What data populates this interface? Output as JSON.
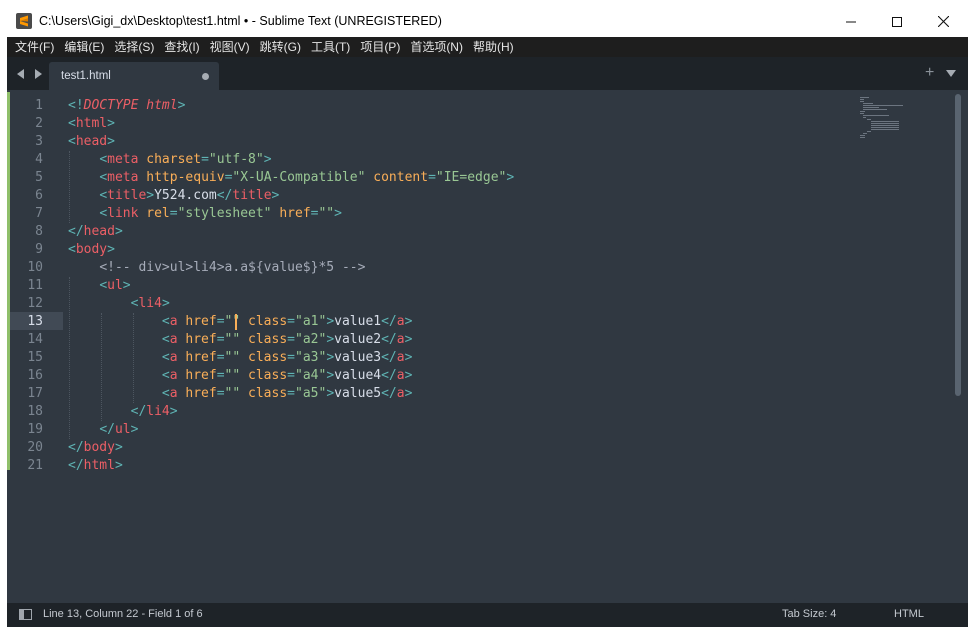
{
  "window": {
    "title": "C:\\Users\\Gigi_dx\\Desktop\\test1.html • - Sublime Text (UNREGISTERED)",
    "app_icon": "sublime-text-logo",
    "controls": [
      "minimize-icon",
      "maximize-icon",
      "close-icon"
    ]
  },
  "menu": [
    "文件(F)",
    "编辑(E)",
    "选择(S)",
    "查找(I)",
    "视图(V)",
    "跳转(G)",
    "工具(T)",
    "项目(P)",
    "首选项(N)",
    "帮助(H)"
  ],
  "tabbar": {
    "tab_label": "test1.html",
    "tab_modified": true,
    "icons": [
      "arrow-left-icon",
      "arrow-right-icon",
      "plus-icon",
      "chevron-down-icon"
    ],
    "add_symbol": "+"
  },
  "editor": {
    "active_line": 13,
    "line_numbers": [
      "1",
      "2",
      "3",
      "4",
      "5",
      "6",
      "7",
      "8",
      "9",
      "10",
      "11",
      "12",
      "13",
      "14",
      "15",
      "16",
      "17",
      "18",
      "19",
      "20",
      "21"
    ],
    "lines": [
      [
        [
          "p",
          "<!"
        ],
        [
          "d",
          "DOCTYPE"
        ],
        [
          "x",
          " "
        ],
        [
          "d",
          "html"
        ],
        [
          "p",
          ">"
        ]
      ],
      [
        [
          "p",
          "<"
        ],
        [
          "t",
          "html"
        ],
        [
          "p",
          ">"
        ]
      ],
      [
        [
          "p",
          "<"
        ],
        [
          "t",
          "head"
        ],
        [
          "p",
          ">"
        ]
      ],
      [
        [
          "x",
          "    "
        ],
        [
          "p",
          "<"
        ],
        [
          "t",
          "meta"
        ],
        [
          "x",
          " "
        ],
        [
          "a",
          "charset"
        ],
        [
          "p",
          "="
        ],
        [
          "s",
          "\"utf-8\""
        ],
        [
          "p",
          ">"
        ]
      ],
      [
        [
          "x",
          "    "
        ],
        [
          "p",
          "<"
        ],
        [
          "t",
          "meta"
        ],
        [
          "x",
          " "
        ],
        [
          "a",
          "http-equiv"
        ],
        [
          "p",
          "="
        ],
        [
          "s",
          "\"X-UA-Compatible\""
        ],
        [
          "x",
          " "
        ],
        [
          "a",
          "content"
        ],
        [
          "p",
          "="
        ],
        [
          "s",
          "\"IE=edge\""
        ],
        [
          "p",
          ">"
        ]
      ],
      [
        [
          "x",
          "    "
        ],
        [
          "p",
          "<"
        ],
        [
          "t",
          "title"
        ],
        [
          "p",
          ">"
        ],
        [
          "x",
          "Y524.com"
        ],
        [
          "p",
          "</"
        ],
        [
          "t",
          "title"
        ],
        [
          "p",
          ">"
        ]
      ],
      [
        [
          "x",
          "    "
        ],
        [
          "p",
          "<"
        ],
        [
          "t",
          "link"
        ],
        [
          "x",
          " "
        ],
        [
          "a",
          "rel"
        ],
        [
          "p",
          "="
        ],
        [
          "s",
          "\"stylesheet\""
        ],
        [
          "x",
          " "
        ],
        [
          "a",
          "href"
        ],
        [
          "p",
          "="
        ],
        [
          "s",
          "\"\""
        ],
        [
          "p",
          ">"
        ]
      ],
      [
        [
          "p",
          "</"
        ],
        [
          "t",
          "head"
        ],
        [
          "p",
          ">"
        ]
      ],
      [
        [
          "p",
          "<"
        ],
        [
          "t",
          "body"
        ],
        [
          "p",
          ">"
        ]
      ],
      [
        [
          "x",
          "    "
        ],
        [
          "c",
          "<!-- div>ul>li4>a.a${value$}*5 -->"
        ]
      ],
      [
        [
          "x",
          "    "
        ],
        [
          "p",
          "<"
        ],
        [
          "t",
          "ul"
        ],
        [
          "p",
          ">"
        ]
      ],
      [
        [
          "x",
          "        "
        ],
        [
          "p",
          "<"
        ],
        [
          "t",
          "li4"
        ],
        [
          "p",
          ">"
        ]
      ],
      [
        [
          "x",
          "            "
        ],
        [
          "p",
          "<"
        ],
        [
          "t",
          "a"
        ],
        [
          "x",
          " "
        ],
        [
          "a",
          "href"
        ],
        [
          "p",
          "="
        ],
        [
          "s",
          "\"\""
        ],
        [
          "x",
          " "
        ],
        [
          "a",
          "class"
        ],
        [
          "p",
          "="
        ],
        [
          "s",
          "\"a1\""
        ],
        [
          "p",
          ">"
        ],
        [
          "x",
          "value1"
        ],
        [
          "p",
          "</"
        ],
        [
          "t",
          "a"
        ],
        [
          "p",
          ">"
        ]
      ],
      [
        [
          "x",
          "            "
        ],
        [
          "p",
          "<"
        ],
        [
          "t",
          "a"
        ],
        [
          "x",
          " "
        ],
        [
          "a",
          "href"
        ],
        [
          "p",
          "="
        ],
        [
          "s",
          "\"\""
        ],
        [
          "x",
          " "
        ],
        [
          "a",
          "class"
        ],
        [
          "p",
          "="
        ],
        [
          "s",
          "\"a2\""
        ],
        [
          "p",
          ">"
        ],
        [
          "x",
          "value2"
        ],
        [
          "p",
          "</"
        ],
        [
          "t",
          "a"
        ],
        [
          "p",
          ">"
        ]
      ],
      [
        [
          "x",
          "            "
        ],
        [
          "p",
          "<"
        ],
        [
          "t",
          "a"
        ],
        [
          "x",
          " "
        ],
        [
          "a",
          "href"
        ],
        [
          "p",
          "="
        ],
        [
          "s",
          "\"\""
        ],
        [
          "x",
          " "
        ],
        [
          "a",
          "class"
        ],
        [
          "p",
          "="
        ],
        [
          "s",
          "\"a3\""
        ],
        [
          "p",
          ">"
        ],
        [
          "x",
          "value3"
        ],
        [
          "p",
          "</"
        ],
        [
          "t",
          "a"
        ],
        [
          "p",
          ">"
        ]
      ],
      [
        [
          "x",
          "            "
        ],
        [
          "p",
          "<"
        ],
        [
          "t",
          "a"
        ],
        [
          "x",
          " "
        ],
        [
          "a",
          "href"
        ],
        [
          "p",
          "="
        ],
        [
          "s",
          "\"\""
        ],
        [
          "x",
          " "
        ],
        [
          "a",
          "class"
        ],
        [
          "p",
          "="
        ],
        [
          "s",
          "\"a4\""
        ],
        [
          "p",
          ">"
        ],
        [
          "x",
          "value4"
        ],
        [
          "p",
          "</"
        ],
        [
          "t",
          "a"
        ],
        [
          "p",
          ">"
        ]
      ],
      [
        [
          "x",
          "            "
        ],
        [
          "p",
          "<"
        ],
        [
          "t",
          "a"
        ],
        [
          "x",
          " "
        ],
        [
          "a",
          "href"
        ],
        [
          "p",
          "="
        ],
        [
          "s",
          "\"\""
        ],
        [
          "x",
          " "
        ],
        [
          "a",
          "class"
        ],
        [
          "p",
          "="
        ],
        [
          "s",
          "\"a5\""
        ],
        [
          "p",
          ">"
        ],
        [
          "x",
          "value5"
        ],
        [
          "p",
          "</"
        ],
        [
          "t",
          "a"
        ],
        [
          "p",
          ">"
        ]
      ],
      [
        [
          "x",
          "        "
        ],
        [
          "p",
          "</"
        ],
        [
          "t",
          "li4"
        ],
        [
          "p",
          ">"
        ]
      ],
      [
        [
          "x",
          "    "
        ],
        [
          "p",
          "</"
        ],
        [
          "t",
          "ul"
        ],
        [
          "p",
          ">"
        ]
      ],
      [
        [
          "p",
          "</"
        ],
        [
          "t",
          "body"
        ],
        [
          "p",
          ">"
        ]
      ],
      [
        [
          "p",
          "</"
        ],
        [
          "t",
          "html"
        ],
        [
          "p",
          ">"
        ]
      ]
    ]
  },
  "colors": {
    "background": "#303841",
    "tag": "#ec5f66",
    "punctuation": "#5fb4b4",
    "attribute": "#f9ae58",
    "string": "#99c794",
    "text": "#d8dee9",
    "comment": "#a6acb9",
    "cursor": "#f9ae58"
  },
  "statusbar": {
    "position": "Line 13, Column 22 - Field 1 of 6",
    "tab_size": "Tab Size: 4",
    "syntax": "HTML"
  }
}
